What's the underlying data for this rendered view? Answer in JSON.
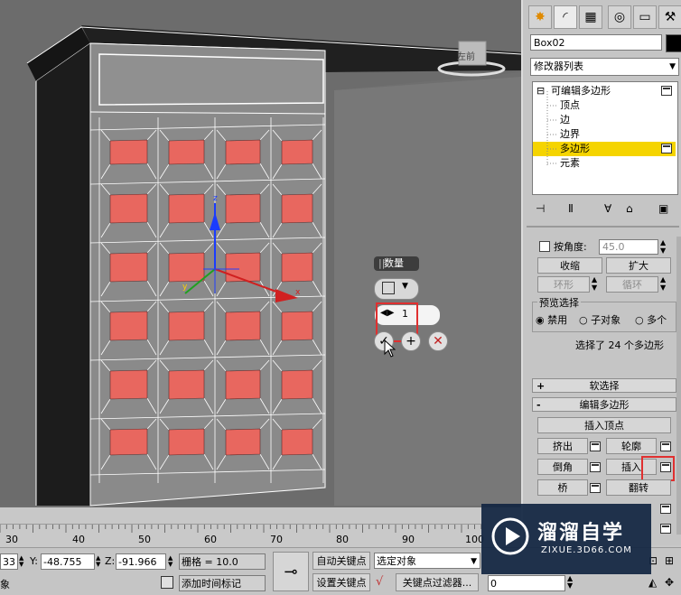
{
  "viewport": {
    "viewcube_label": "左前",
    "gizmo_axes": [
      "x",
      "y",
      "z"
    ]
  },
  "caddy": {
    "title": "数量",
    "amount": "1",
    "amount_arrows": "◀▶"
  },
  "panel": {
    "tabs": [
      {
        "icon": "sun-create-icon"
      },
      {
        "icon": "modify-icon"
      },
      {
        "icon": "hierarchy-icon"
      },
      {
        "icon": "motion-icon"
      },
      {
        "icon": "display-icon"
      },
      {
        "icon": "utilities-icon"
      }
    ],
    "object_name": "Box02",
    "object_color": "#000000",
    "modifier_list": "修改器列表",
    "stack": {
      "root": "可编辑多边形",
      "items": [
        "顶点",
        "边",
        "边界",
        "多边形",
        "元素"
      ],
      "selected": "多边形"
    },
    "by_angle_label": "按角度:",
    "by_angle_value": "45.0",
    "shrink": "收缩",
    "grow": "扩大",
    "ring": "环形",
    "loop": "循环",
    "preview_group": "预览选择",
    "preview_options": [
      "禁用",
      "子对象",
      "多个"
    ],
    "selection_status": "选择了 24 个多边形",
    "soft_selection": "软选择",
    "edit_polygons": "编辑多边形",
    "insert_vertex": "插入顶点",
    "extrude": "挤出",
    "outline": "轮廓",
    "bevel": "倒角",
    "inset": "插入",
    "bridge": "桥",
    "flip": "翻转"
  },
  "ruler": {
    "ticks": [
      "30",
      "40",
      "50",
      "60",
      "70",
      "80",
      "90",
      "100"
    ]
  },
  "status": {
    "x_value": "33",
    "y_label": "Y:",
    "y_value": "-48.755",
    "z_label": "Z:",
    "z_value": "-91.966",
    "grid": "栅格 = 10.0",
    "auto_key": "自动关键点",
    "selected_set": "选定对象",
    "set_key": "设置关键点",
    "key_filters": "关键点过滤器...",
    "add_time_tag": "添加时间标记",
    "left_cut": "象",
    "frame_value": "0"
  },
  "watermark": {
    "name": "溜溜自学",
    "url": "ZIXUE.3D66.COM"
  },
  "colors": {
    "selected_face": "#e8675f",
    "stack_highlight": "#f5d400",
    "annotation_red": "#e03030"
  }
}
